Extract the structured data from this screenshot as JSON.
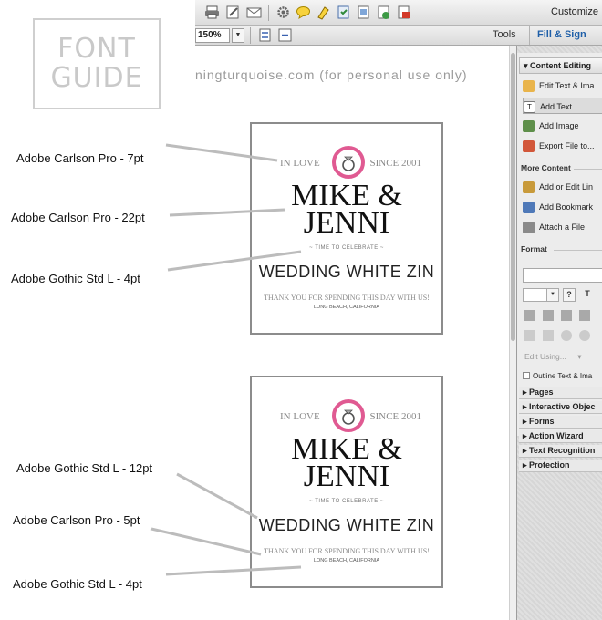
{
  "guide": {
    "title_line1": "FONT",
    "title_line2": "GUIDE",
    "callouts": [
      "Adobe Carlson Pro - 7pt",
      "Adobe Carlson Pro - 22pt",
      "Adobe Gothic Std L - 4pt",
      "Adobe Gothic Std L - 12pt",
      "Adobe Carlson Pro - 5pt",
      "Adobe Gothic Std L - 4pt"
    ]
  },
  "toolbar": {
    "customize_label": "Customize",
    "zoom_value": "150%",
    "tools_label": "Tools",
    "fill_sign_label": "Fill & Sign"
  },
  "document": {
    "header_text": "ningturquoise.com (for personal use only)",
    "card": {
      "in_love": "IN LOVE",
      "since": "SINCE 2001",
      "name_line1": "MIKE &",
      "name_line2": "JENNI",
      "celebrate": "~ TIME TO CELEBRATE ~",
      "title": "WEDDING WHITE ZIN",
      "thanks": "THANK YOU FOR SPENDING THIS DAY WITH US!",
      "location": "LONG BEACH, CALIFORNIA"
    }
  },
  "tools_pane": {
    "content_editing_header": "▾ Content Editing",
    "items": [
      "Edit Text & Ima",
      "Add Text",
      "Add Image",
      "Export File to..."
    ],
    "more_content_heading": "More Content",
    "more_items": [
      "Add or Edit Lin",
      "Add Bookmark",
      "Attach a File"
    ],
    "format_heading": "Format",
    "format_question": "?",
    "format_t": "T",
    "edit_using": "Edit Using...",
    "edit_using_arrow": "▾",
    "outline_text": "Outline Text & Ima",
    "collapsed_panels": [
      "▸ Pages",
      "▸ Interactive Objec",
      "▸ Forms",
      "▸ Action Wizard",
      "▸ Text Recognition",
      "▸ Protection"
    ]
  },
  "colors": {
    "accent_pink": "#e05a92",
    "link_blue": "#1f5fa8"
  }
}
